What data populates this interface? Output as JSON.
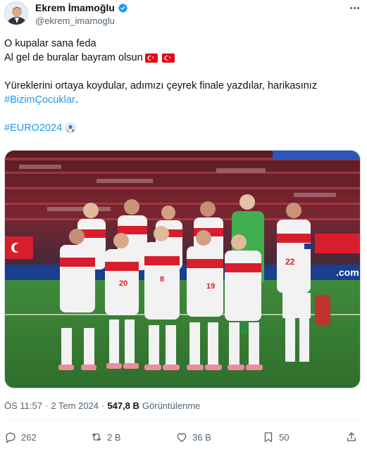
{
  "author": {
    "display_name": "Ekrem İmamoğlu",
    "handle": "@ekrem_imamoglu",
    "verified_icon": "verified-badge-icon"
  },
  "tweet": {
    "line1": "O kupalar sana feda",
    "line2": "Al gel de buralar bayram olsun",
    "line3": "Yüreklerini ortaya koydular, adımızı çeyrek finale yazdılar, harikasınız",
    "hashtag1": "#BizimÇocuklar",
    "hashtag1_suffix": ".",
    "hashtag2": "#EURO2024"
  },
  "meta": {
    "time": "ÖS 11:57",
    "separator": "·",
    "date": "2 Tem 2024",
    "separator2": "·",
    "views_count": "547,8 B",
    "views_label": "Görüntülenme"
  },
  "actions": {
    "replies": "262",
    "retweets": "2 B",
    "likes": "36 B",
    "bookmarks": "50"
  },
  "colors": {
    "accent": "#1d9bf0",
    "text": "#0f1419",
    "muted": "#536471",
    "flag_red": "#e30a17"
  }
}
